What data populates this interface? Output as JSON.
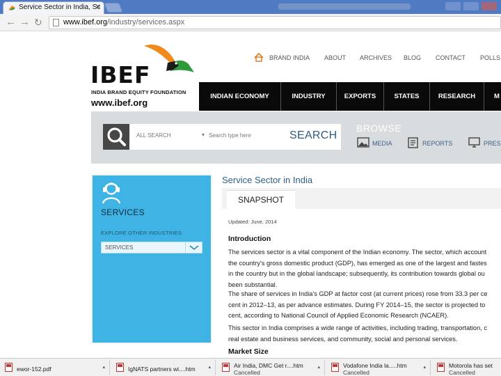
{
  "browser": {
    "tab_title": "Service Sector in India, Sc",
    "url_host": "www.ibef.org",
    "url_path": "/industry/services.aspx"
  },
  "logo": {
    "wordmark": "IBEF",
    "tagline": "INDIA BRAND EQUITY FOUNDATION",
    "url": "www.ibef.org"
  },
  "topnav": [
    "BRAND INDIA",
    "ABOUT",
    "ARCHIVES",
    "BLOG",
    "CONTACT",
    "POLLS"
  ],
  "mainnav": [
    "INDIAN ECONOMY",
    "INDUSTRY",
    "EXPORTS",
    "STATES",
    "RESEARCH",
    "M"
  ],
  "search": {
    "scope": "ALL SEARCH",
    "placeholder": "Search type here",
    "button": "SEARCH"
  },
  "browse": {
    "title": "BROWSE",
    "links": [
      "MEDIA",
      "REPORTS",
      "PRES"
    ]
  },
  "sidebar": {
    "title": "SERVICES",
    "subtitle": "EXPLORE OTHER INDUSTRIES",
    "select_value": "SERVICES"
  },
  "content": {
    "title": "Service Sector in India",
    "tab": "SNAPSHOT",
    "updated": "Updated: June, 2014",
    "intro_heading": "Introduction",
    "para1": [
      "The services sector is a vital component of the Indian economy. The sector, which account",
      "the country's gross domestic product (GDP), has emerged as one of the largest and fastes",
      "in the country but in the global landscape; subsequently, its contribution towards global ou",
      "been substantial."
    ],
    "para2": [
      "The share of services in India's GDP at factor cost (at current prices) rose from 33.3 per ce",
      "cent in 2012–13, as per advance estimates. During FY 2014–15, the sector is projected to",
      "cent, according to National Council of Applied Economic Research (NCAER)."
    ],
    "para3": [
      "This sector in India comprises a wide range of activities, including trading, transportation, c",
      "real estate and business services, and community, social and personal services."
    ],
    "market_heading": "Market Size"
  },
  "downloads": [
    {
      "name": "ewor-152.pdf",
      "status": ""
    },
    {
      "name": "IgNATS partners wi....htm",
      "status": ""
    },
    {
      "name": "Air India, DMC Get r....htm",
      "status": "Cancelled"
    },
    {
      "name": "Vodafone India la.....htm",
      "status": "Cancelled"
    },
    {
      "name": "Motorola has set",
      "status": "Cancelled"
    }
  ]
}
